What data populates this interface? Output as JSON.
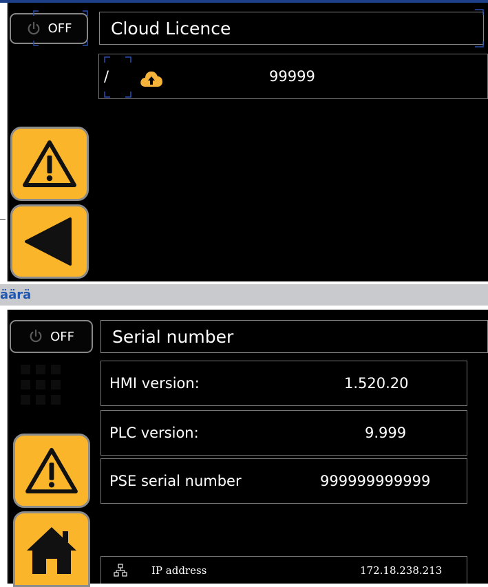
{
  "screen1": {
    "off_label": "OFF",
    "title": "Cloud Licence",
    "licence_row": {
      "slash": "/",
      "value": "99999"
    }
  },
  "section": {
    "text": "äärä"
  },
  "screen2": {
    "off_label": "OFF",
    "title": "Serial number",
    "rows": [
      {
        "label": "HMI version:",
        "value": "1.520.20"
      },
      {
        "label": "PLC version:",
        "value": "9.999"
      },
      {
        "label": "PSE serial number",
        "value": "999999999999"
      }
    ],
    "ip": {
      "label": "IP address",
      "value": "172.18.238.213"
    }
  },
  "icons": {
    "power": "power-icon",
    "cloud": "cloud-upload-icon",
    "warning": "warning-icon",
    "back": "back-arrow-icon",
    "home": "home-icon",
    "network": "network-icon"
  },
  "colors": {
    "accent_yellow": "#fbb52a",
    "screen_bg": "#000000",
    "section_text": "#1f57b0",
    "top_bar": "#1e3f8a"
  }
}
